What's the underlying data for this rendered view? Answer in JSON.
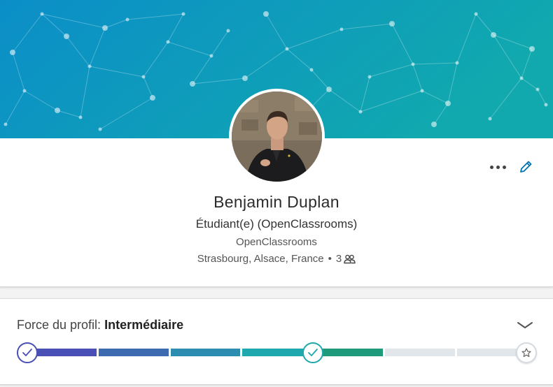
{
  "profile": {
    "name": "Benjamin Duplan",
    "headline": "Étudiant(e) (OpenClassrooms)",
    "company": "OpenClassrooms",
    "location": "Strasbourg, Alsace, France",
    "separator": "•",
    "connections": "3",
    "more_icon": "more-dots-icon",
    "edit_icon": "pencil-icon",
    "connections_icon": "people-icon"
  },
  "strength": {
    "label": "Force du profil:",
    "level": "Intermédiaire",
    "expand_icon": "chevron-down-icon",
    "total_steps": 7,
    "current_step": 4,
    "segment_colors": [
      "#4a4fb5",
      "#3e6ab0",
      "#2d8db0",
      "#1fa8ae",
      "#1f9a7a",
      "#e1e6ea",
      "#e1e6ea"
    ],
    "start_icon": "check-circle-icon",
    "current_icon": "check-circle-icon",
    "end_icon": "star-icon"
  },
  "colors": {
    "banner_start": "#0a8fc9",
    "banner_end": "#10a8b0",
    "accent": "#0073b1"
  }
}
